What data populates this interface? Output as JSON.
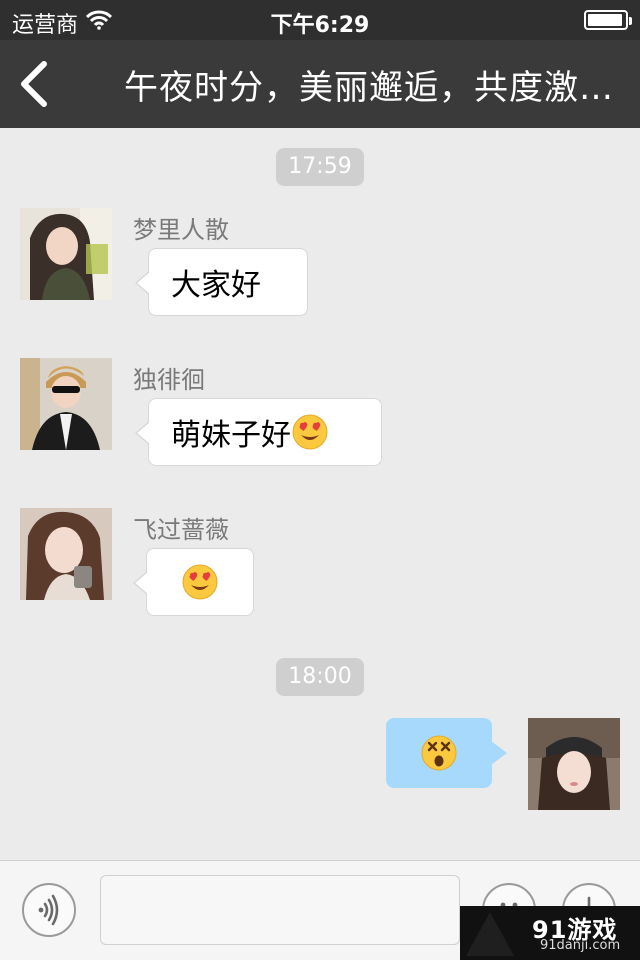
{
  "status_bar": {
    "carrier": "运营商",
    "time": "下午6:29",
    "battery_level": 0.95
  },
  "nav": {
    "title": "午夜时分，美丽邂逅，共度激…"
  },
  "chat": {
    "timestamps": [
      "17:59",
      "18:00"
    ],
    "messages": [
      {
        "sender": "梦里人散",
        "text": "大家好",
        "emoji": ""
      },
      {
        "sender": "独徘徊",
        "text": "萌妹子好",
        "emoji": "heart-eyes-emoji"
      },
      {
        "sender": "飞过蔷薇",
        "text": "",
        "emoji": "heart-eyes-emoji"
      },
      {
        "sender": "",
        "text": "",
        "emoji": "dizzy-face-emoji",
        "outgoing": true
      }
    ]
  },
  "input": {
    "placeholder": ""
  },
  "watermark": {
    "logo": "91游戏",
    "site": "91danji.com"
  },
  "colors": {
    "nav_bg": "#3a3a3a",
    "chat_bg": "#ebebeb",
    "outgoing_bubble": "#a6d9fb"
  }
}
